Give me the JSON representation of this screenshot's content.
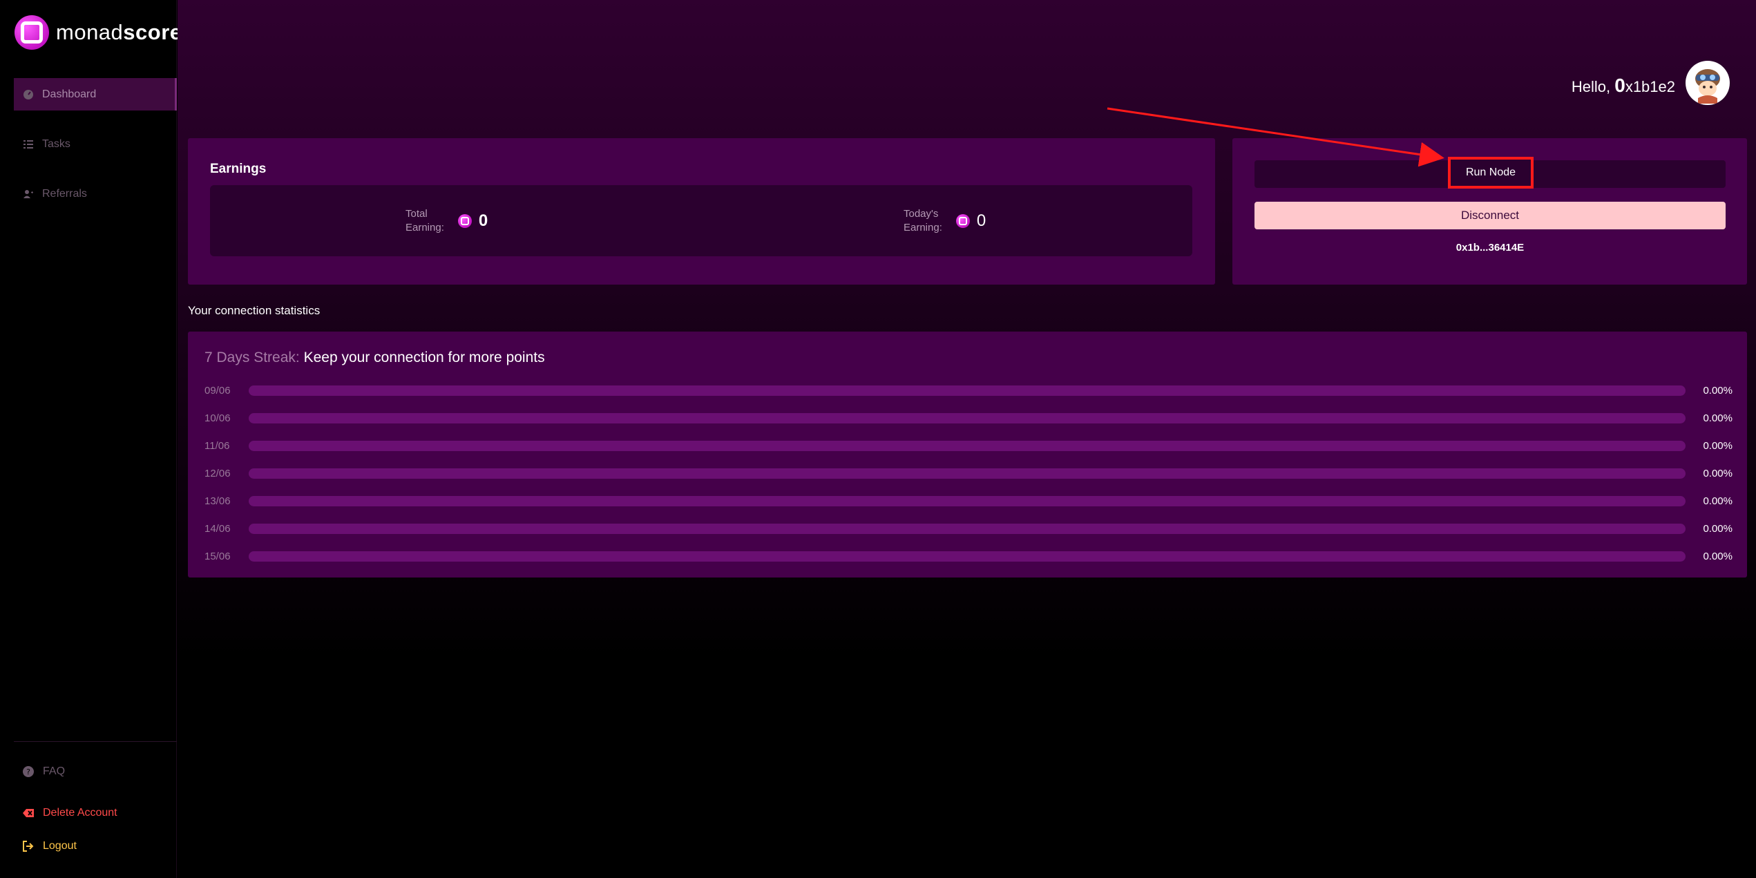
{
  "brand": {
    "name_light": "monad",
    "name_bold": "score"
  },
  "sidebar": {
    "items": [
      {
        "label": "Dashboard",
        "icon": "dashboard-icon",
        "active": true
      },
      {
        "label": "Tasks",
        "icon": "tasks-icon",
        "active": false
      },
      {
        "label": "Referrals",
        "icon": "user-plus-icon",
        "active": false
      }
    ],
    "faq": "FAQ",
    "delete_account": "Delete Account",
    "logout": "Logout"
  },
  "header": {
    "greeting": "Hello,",
    "user_initial": "0",
    "user_rest": "x1b1e2"
  },
  "earnings": {
    "title": "Earnings",
    "total_label_1": "Total",
    "total_label_2": "Earning:",
    "total_value": "0",
    "today_label_1": "Today's",
    "today_label_2": "Earning:",
    "today_value": "0"
  },
  "node": {
    "run_label": "Run Node",
    "disconnect_label": "Disconnect",
    "address": "0x1b...36414E"
  },
  "stats": {
    "caption": "Your connection statistics",
    "streak_prefix": "7 Days Streak:",
    "streak_text": "Keep your connection for more points",
    "rows": [
      {
        "date": "09/06",
        "percent": "0.00%",
        "value": 0
      },
      {
        "date": "10/06",
        "percent": "0.00%",
        "value": 0
      },
      {
        "date": "11/06",
        "percent": "0.00%",
        "value": 0
      },
      {
        "date": "12/06",
        "percent": "0.00%",
        "value": 0
      },
      {
        "date": "13/06",
        "percent": "0.00%",
        "value": 0
      },
      {
        "date": "14/06",
        "percent": "0.00%",
        "value": 0
      },
      {
        "date": "15/06",
        "percent": "0.00%",
        "value": 0
      }
    ]
  },
  "colors": {
    "accent": "#c414c4",
    "card": "#45004a",
    "annotation": "#ff1a1a",
    "delete": "#ff4a4a",
    "logout": "#ffc64a"
  }
}
